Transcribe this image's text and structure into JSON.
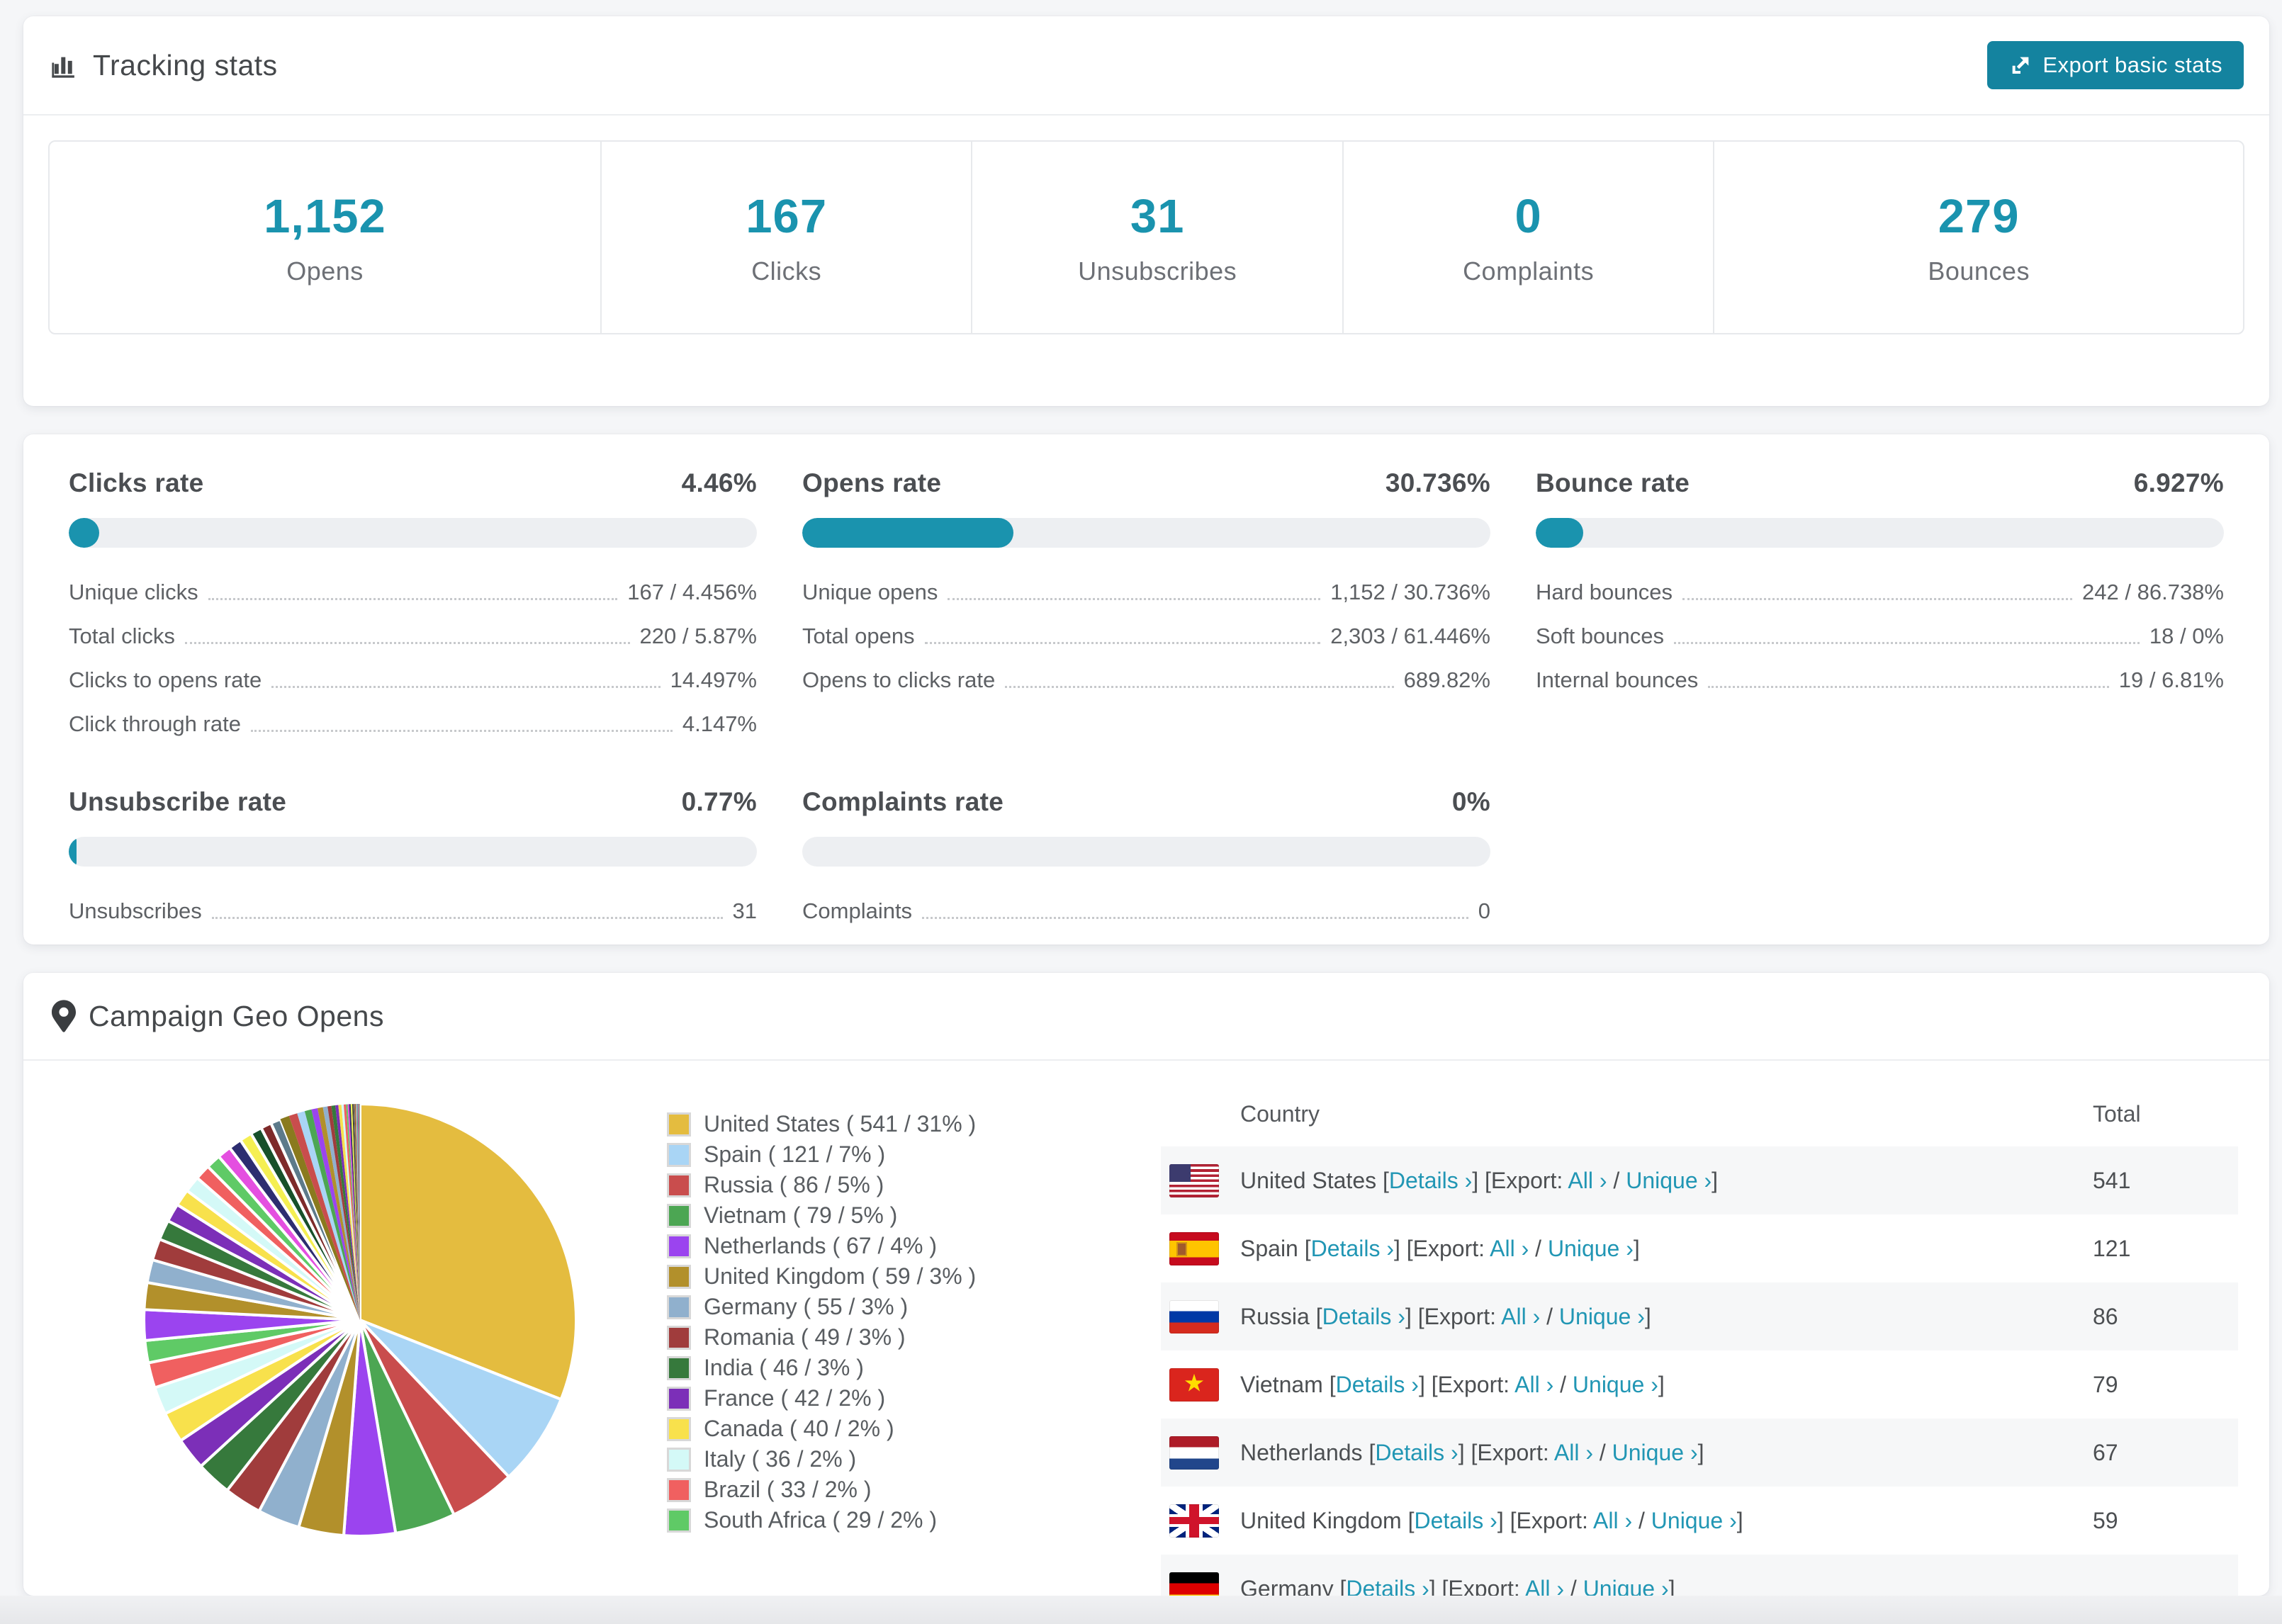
{
  "tracking": {
    "title": "Tracking stats",
    "export_button": "Export basic stats",
    "accent_color": "#1a93ae",
    "button_color": "#14839f",
    "cards": [
      {
        "value": "1,152",
        "label": "Opens"
      },
      {
        "value": "167",
        "label": "Clicks"
      },
      {
        "value": "31",
        "label": "Unsubscribes"
      },
      {
        "value": "0",
        "label": "Complaints"
      },
      {
        "value": "279",
        "label": "Bounces"
      }
    ]
  },
  "rates": {
    "panels": [
      {
        "title": "Clicks rate",
        "value": "4.46%",
        "fill_pct": 4.46,
        "rows": [
          {
            "label": "Unique clicks",
            "value": "167 / 4.456%"
          },
          {
            "label": "Total clicks",
            "value": "220 / 5.87%"
          },
          {
            "label": "Clicks to opens rate",
            "value": "14.497%"
          },
          {
            "label": "Click through rate",
            "value": "4.147%"
          }
        ]
      },
      {
        "title": "Opens rate",
        "value": "30.736%",
        "fill_pct": 30.736,
        "rows": [
          {
            "label": "Unique opens",
            "value": "1,152 / 30.736%"
          },
          {
            "label": "Total opens",
            "value": "2,303 / 61.446%"
          },
          {
            "label": "Opens to clicks rate",
            "value": "689.82%"
          }
        ]
      },
      {
        "title": "Bounce rate",
        "value": "6.927%",
        "fill_pct": 6.927,
        "rows": [
          {
            "label": "Hard bounces",
            "value": "242 / 86.738%"
          },
          {
            "label": "Soft bounces",
            "value": "18 / 0%"
          },
          {
            "label": "Internal bounces",
            "value": "19 / 6.81%"
          }
        ]
      },
      {
        "title": "Unsubscribe rate",
        "value": "0.77%",
        "fill_pct": 0.77,
        "rows": [
          {
            "label": "Unsubscribes",
            "value": "31"
          }
        ]
      },
      {
        "title": "Complaints rate",
        "value": "0%",
        "fill_pct": 0,
        "rows": [
          {
            "label": "Complaints",
            "value": "0"
          }
        ]
      }
    ]
  },
  "geo": {
    "title": "Campaign Geo Opens",
    "legend": [
      {
        "label": "United States ( 541 / 31% )",
        "color": "#e4bc3f"
      },
      {
        "label": "Spain ( 121 / 7% )",
        "color": "#a9d5f5"
      },
      {
        "label": "Russia ( 86 / 5% )",
        "color": "#c94d4d"
      },
      {
        "label": "Vietnam ( 79 / 5% )",
        "color": "#4ca653"
      },
      {
        "label": "Netherlands ( 67 / 4% )",
        "color": "#9b44ef"
      },
      {
        "label": "United Kingdom ( 59 / 3% )",
        "color": "#b2902b"
      },
      {
        "label": "Germany ( 55 / 3% )",
        "color": "#90b0cd"
      },
      {
        "label": "Romania ( 49 / 3% )",
        "color": "#a03c3c"
      },
      {
        "label": "India ( 46 / 3% )",
        "color": "#36793c"
      },
      {
        "label": "France ( 42 / 2% )",
        "color": "#7c2fb8"
      },
      {
        "label": "Canada ( 40 / 2% )",
        "color": "#f8e14c"
      },
      {
        "label": "Italy ( 36 / 2% )",
        "color": "#d4f9f7"
      },
      {
        "label": "Brazil ( 33 / 2% )",
        "color": "#f06060"
      },
      {
        "label": "South Africa ( 29 / 2% )",
        "color": "#5fca66"
      }
    ],
    "table": {
      "headers": {
        "country": "Country",
        "total": "Total"
      },
      "link_labels": {
        "details": "Details",
        "export": "Export:",
        "all": "All",
        "unique": "Unique",
        "chevron": "›"
      },
      "link_color": "#2196b4",
      "rows": [
        {
          "country": "United States",
          "flag": "us",
          "total": "541"
        },
        {
          "country": "Spain",
          "flag": "es",
          "total": "121"
        },
        {
          "country": "Russia",
          "flag": "ru",
          "total": "86"
        },
        {
          "country": "Vietnam",
          "flag": "vn",
          "total": "79"
        },
        {
          "country": "Netherlands",
          "flag": "nl",
          "total": "67"
        },
        {
          "country": "United Kingdom",
          "flag": "gb",
          "total": "59"
        },
        {
          "country": "Germany",
          "flag": "de",
          "total": ""
        }
      ]
    },
    "chart_data": {
      "type": "pie",
      "title": "Campaign Geo Opens",
      "legend_position": "right",
      "start_angle_deg": -90,
      "direction": "clockwise",
      "labels": [
        "United States",
        "Spain",
        "Russia",
        "Vietnam",
        "Netherlands",
        "United Kingdom",
        "Germany",
        "Romania",
        "India",
        "France",
        "Canada",
        "Italy",
        "Brazil",
        "South Africa"
      ],
      "values": [
        541,
        121,
        86,
        79,
        67,
        59,
        55,
        49,
        46,
        42,
        40,
        36,
        33,
        29
      ],
      "colors": [
        "#e4bc3f",
        "#a9d5f5",
        "#c94d4d",
        "#4ca653",
        "#9b44ef",
        "#b2902b",
        "#90b0cd",
        "#a03c3c",
        "#36793c",
        "#7c2fb8",
        "#f8e14c",
        "#d4f9f7",
        "#f06060",
        "#5fca66"
      ],
      "others_values": [
        40,
        35,
        30,
        28,
        26,
        24,
        22,
        21,
        20,
        19,
        18,
        17,
        16,
        15,
        14,
        13,
        12,
        11,
        10,
        9,
        8,
        7,
        6,
        5,
        5,
        4,
        4,
        3,
        3,
        2,
        2,
        2,
        2,
        1,
        1,
        1,
        1,
        1,
        1,
        1,
        1,
        1,
        1
      ],
      "others_colors": [
        "#9b44ef",
        "#b2902b",
        "#90b0cd",
        "#a03c3c",
        "#36793c",
        "#7c2fb8",
        "#f8e14c",
        "#d4f9f7",
        "#f06060",
        "#5fca66",
        "#e44fe0",
        "#2d2d70",
        "#f5ef52",
        "#17502a",
        "#7e2a2a",
        "#5d7a8a",
        "#8a7a1e",
        "#c94d4d",
        "#a9d5f5",
        "#4ca653"
      ]
    }
  }
}
